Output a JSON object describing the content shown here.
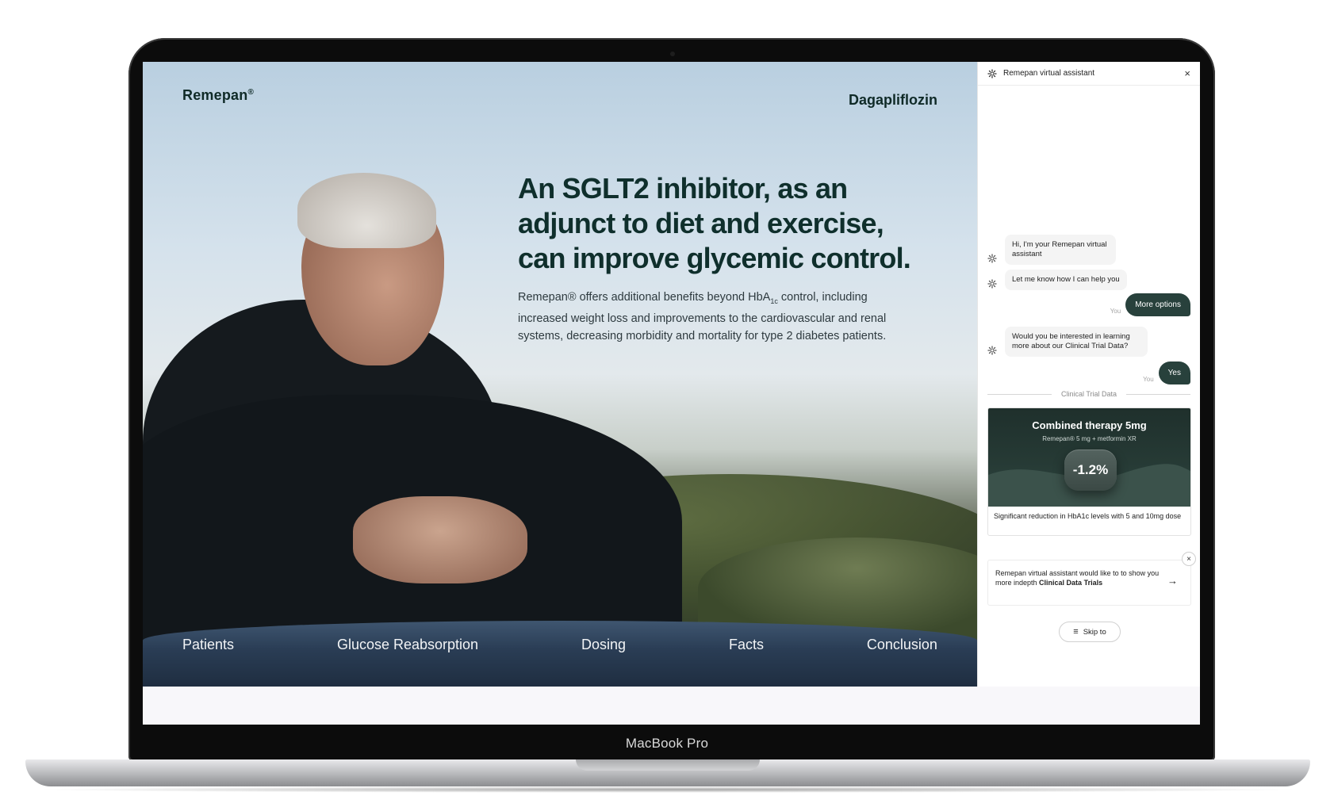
{
  "device": {
    "label": "MacBook Pro"
  },
  "site": {
    "brand": "Remepan",
    "brand_mark": "®",
    "product": "Dagapliflozin",
    "heading": "An SGLT2 inhibitor, as an adjunct to diet and exercise, can improve glycemic control.",
    "body_part1": "Remepan® offers additional benefits beyond HbA",
    "body_sub": "1c",
    "body_part2": " control, including increased weight loss and improvements to the cardiovascular and renal systems, decreasing morbidity and mortality for type 2 diabetes patients.",
    "nav": [
      "Patients",
      "Glucose Reabsorption",
      "Dosing",
      "Facts",
      "Conclusion"
    ]
  },
  "chat": {
    "title": "Remepan virtual assistant",
    "close_icon": "close-icon",
    "messages": {
      "bot1": "Hi, I'm your Remepan virtual assistant",
      "bot2": "Let me know how I can help you",
      "user1": "More options",
      "bot3": "Would you be interested in learning more about our Clinical Trial Data?",
      "user2": "Yes",
      "you_label": "You"
    },
    "divider": "Clinical Trial Data",
    "card": {
      "title": "Combined therapy 5mg",
      "subtitle": "Remepan® 5 mg + metformin XR",
      "value": "-1.2%",
      "caption": "Significant reduction in HbA1c levels with 5 and 10mg dose"
    },
    "promo": {
      "text": "Remepan virtual assistant would like to to show you more indepth ",
      "bold": "Clinical Data Trials",
      "arrow": "→",
      "close": "×"
    },
    "skip_label": "Skip to",
    "skip_icon": "≡"
  },
  "colors": {
    "accent": "#28413c",
    "heading": "#0f2f2c"
  }
}
